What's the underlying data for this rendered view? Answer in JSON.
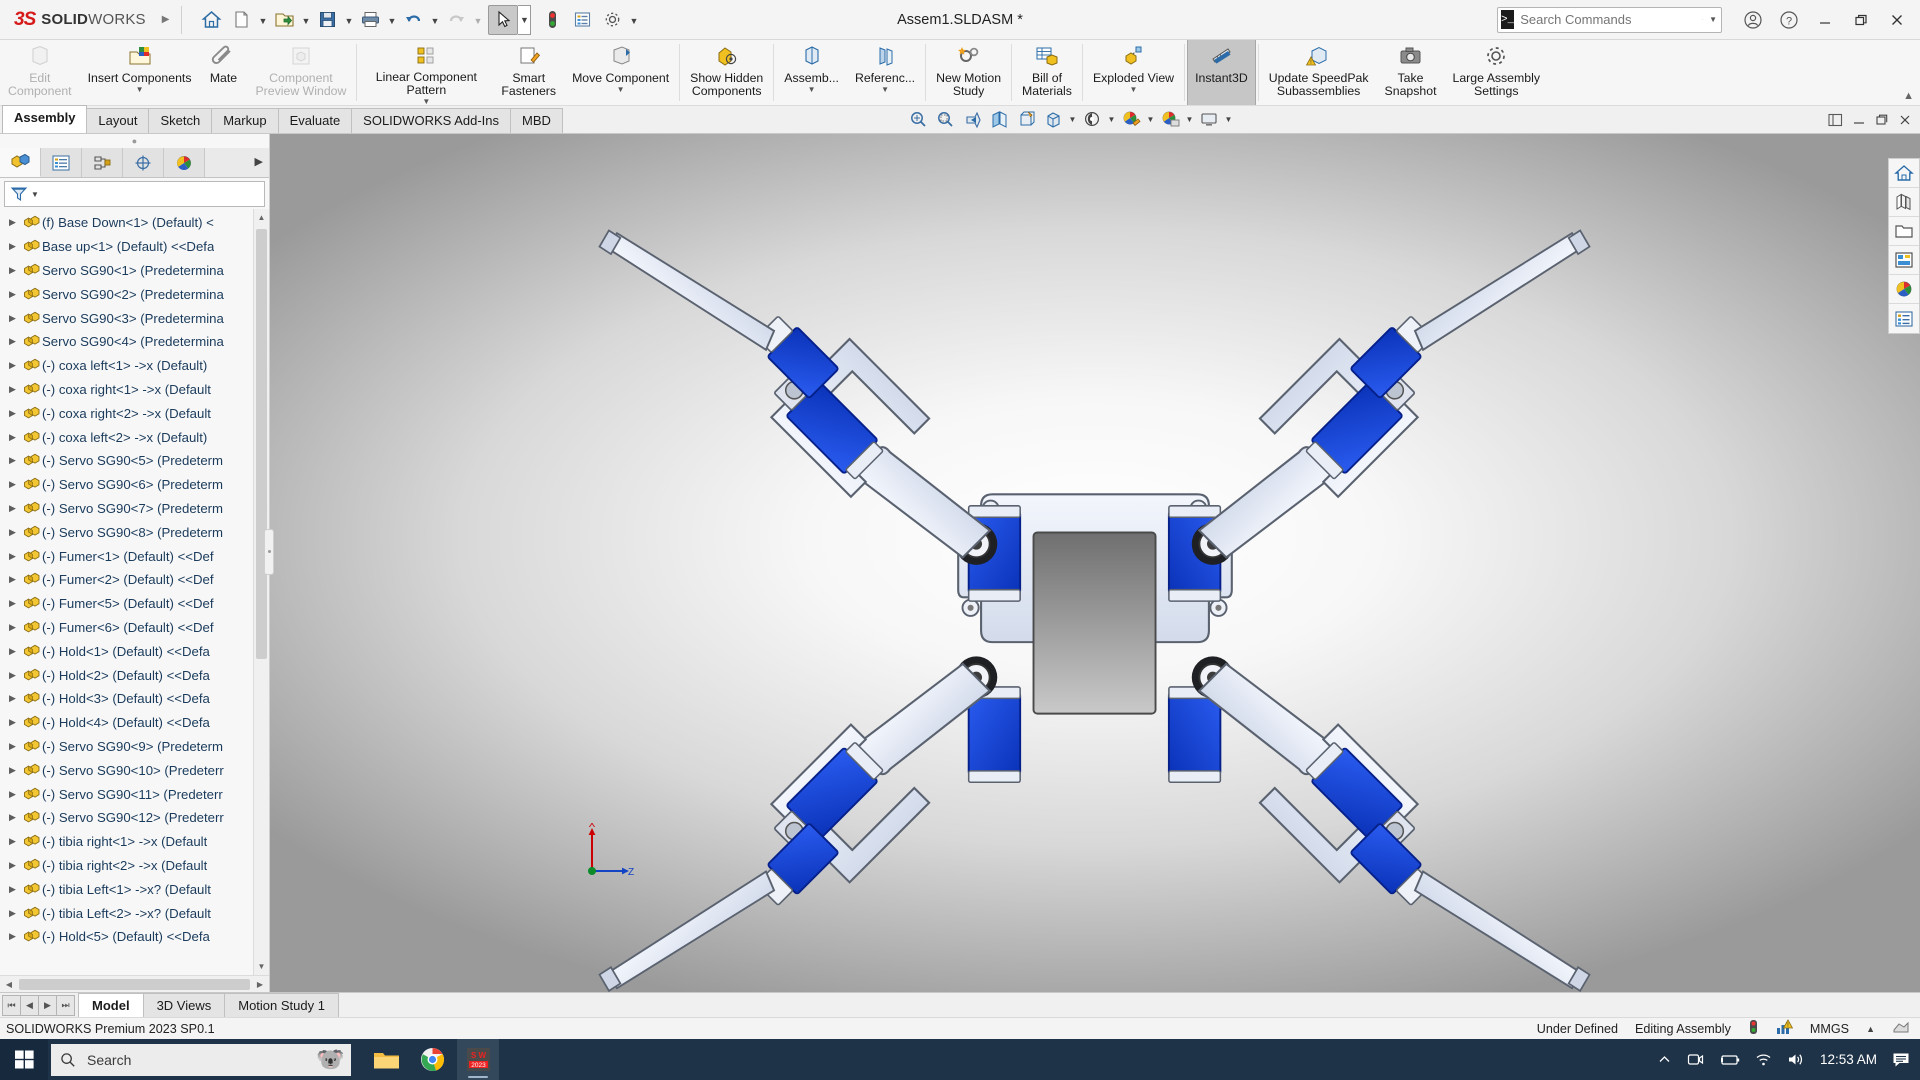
{
  "titlebar": {
    "brand_ds": "3S",
    "brand_bold": "SOLID",
    "brand_light": "WORKS",
    "document_title": "Assem1.SLDASM *",
    "quick_access": [
      {
        "name": "home-icon",
        "label": "Home"
      },
      {
        "name": "new-document-icon",
        "label": "New"
      },
      {
        "name": "open-document-icon",
        "label": "Open"
      },
      {
        "name": "save-icon",
        "label": "Save"
      },
      {
        "name": "print-icon",
        "label": "Print"
      },
      {
        "name": "undo-icon",
        "label": "Undo"
      },
      {
        "name": "redo-icon",
        "label": "Redo"
      },
      {
        "name": "select-cursor-icon",
        "label": "Select"
      },
      {
        "name": "rebuild-icon",
        "label": "Rebuild"
      },
      {
        "name": "file-properties-icon",
        "label": "File Properties"
      },
      {
        "name": "options-gear-icon",
        "label": "Options"
      }
    ],
    "search_placeholder": "Search Commands",
    "window_controls": [
      "minimize",
      "restore",
      "close"
    ]
  },
  "ribbon": {
    "items": [
      {
        "label": "Edit\nComponent",
        "icon": "edit-component-icon",
        "disabled": true,
        "caret": false
      },
      {
        "label": "Insert Components",
        "icon": "insert-components-icon",
        "disabled": false,
        "caret": true
      },
      {
        "label": "Mate",
        "icon": "mate-paperclip-icon",
        "disabled": false,
        "caret": false
      },
      {
        "label": "Component\nPreview Window",
        "icon": "component-preview-icon",
        "disabled": true,
        "caret": false
      },
      {
        "label": "Linear Component Pattern",
        "icon": "linear-pattern-icon",
        "disabled": false,
        "caret": true
      },
      {
        "label": "Smart\nFasteners",
        "icon": "smart-fasteners-icon",
        "disabled": false,
        "caret": false
      },
      {
        "label": "Move Component",
        "icon": "move-component-icon",
        "disabled": false,
        "caret": true
      },
      {
        "label": "Show Hidden\nComponents",
        "icon": "show-hidden-components-icon",
        "disabled": false,
        "caret": false
      },
      {
        "label": "Assemb...",
        "icon": "assembly-features-icon",
        "disabled": false,
        "caret": true
      },
      {
        "label": "Referenc...",
        "icon": "reference-geometry-icon",
        "disabled": false,
        "caret": true
      },
      {
        "label": "New Motion\nStudy",
        "icon": "new-motion-study-icon",
        "disabled": false,
        "caret": false
      },
      {
        "label": "Bill of\nMaterials",
        "icon": "bill-of-materials-icon",
        "disabled": false,
        "caret": false
      },
      {
        "label": "Exploded View",
        "icon": "exploded-view-icon",
        "disabled": false,
        "caret": true
      },
      {
        "label": "Instant3D",
        "icon": "instant3d-icon",
        "disabled": false,
        "caret": false,
        "selected": true
      },
      {
        "label": "Update SpeedPak\nSubassemblies",
        "icon": "update-speedpak-icon",
        "disabled": false,
        "caret": false
      },
      {
        "label": "Take\nSnapshot",
        "icon": "take-snapshot-icon",
        "disabled": false,
        "caret": false
      },
      {
        "label": "Large Assembly\nSettings",
        "icon": "large-assembly-settings-icon",
        "disabled": false,
        "caret": false
      }
    ]
  },
  "command_tabs": [
    {
      "label": "Assembly",
      "active": true
    },
    {
      "label": "Layout",
      "active": false
    },
    {
      "label": "Sketch",
      "active": false
    },
    {
      "label": "Markup",
      "active": false
    },
    {
      "label": "Evaluate",
      "active": false
    },
    {
      "label": "SOLIDWORKS Add-Ins",
      "active": false
    },
    {
      "label": "MBD",
      "active": false
    }
  ],
  "view_toolbar": [
    {
      "name": "zoom-to-fit-icon",
      "caret": false
    },
    {
      "name": "zoom-to-area-icon",
      "caret": false
    },
    {
      "name": "previous-view-icon",
      "caret": false
    },
    {
      "name": "section-view-icon",
      "caret": false
    },
    {
      "name": "view-orientation-icon",
      "caret": false
    },
    {
      "name": "display-style-icon",
      "caret": true
    },
    {
      "name": "hide-show-items-icon",
      "caret": true
    },
    {
      "name": "edit-appearance-icon",
      "caret": true
    },
    {
      "name": "apply-scene-icon",
      "caret": true
    },
    {
      "name": "view-settings-icon",
      "caret": true
    }
  ],
  "feature_manager": {
    "panel_tabs": [
      {
        "name": "featuremanager-design-tree-tab",
        "active": true
      },
      {
        "name": "property-manager-tab",
        "active": false
      },
      {
        "name": "configuration-manager-tab",
        "active": false
      },
      {
        "name": "dimxpert-manager-tab",
        "active": false
      },
      {
        "name": "display-manager-tab",
        "active": false
      }
    ],
    "filter_placeholder": "",
    "tree_items": [
      "(f) Base Down<1> (Default) <",
      "Base up<1> (Default) <<Defa",
      "Servo SG90<1> (Predetermina",
      "Servo SG90<2> (Predetermina",
      "Servo SG90<3> (Predetermina",
      "Servo SG90<4> (Predetermina",
      "(-) coxa left<1> ->x (Default)",
      "(-) coxa right<1> ->x (Default",
      "(-) coxa right<2> ->x (Default",
      "(-) coxa left<2> ->x (Default)",
      "(-) Servo SG90<5> (Predeterm",
      "(-) Servo SG90<6> (Predeterm",
      "(-) Servo SG90<7> (Predeterm",
      "(-) Servo SG90<8> (Predeterm",
      "(-) Fumer<1> (Default) <<Def",
      "(-) Fumer<2> (Default) <<Def",
      "(-) Fumer<5> (Default) <<Def",
      "(-) Fumer<6> (Default) <<Def",
      "(-) Hold<1> (Default) <<Defa",
      "(-) Hold<2> (Default) <<Defa",
      "(-) Hold<3> (Default) <<Defa",
      "(-) Hold<4> (Default) <<Defa",
      "(-) Servo SG90<9> (Predeterm",
      "(-) Servo SG90<10> (Predeterr",
      "(-) Servo SG90<11> (Predeterr",
      "(-) Servo SG90<12> (Predeterr",
      "(-) tibia right<1> ->x (Default",
      "(-) tibia right<2> ->x (Default",
      "(-) tibia Left<1> ->x? (Default",
      "(-) tibia Left<2> ->x? (Default",
      "(-) Hold<5> (Default) <<Defa"
    ]
  },
  "graphics": {
    "triad": {
      "x_label": "X",
      "z_label": "Z"
    },
    "view_side_buttons": [
      {
        "name": "home-view-icon"
      },
      {
        "name": "appearances-icon"
      },
      {
        "name": "open-folder-icon"
      },
      {
        "name": "custom-properties-icon"
      },
      {
        "name": "render-appearance-icon"
      },
      {
        "name": "display-pane-icon"
      }
    ]
  },
  "bottom_tabs": [
    {
      "label": "Model",
      "active": true
    },
    {
      "label": "3D Views",
      "active": false
    },
    {
      "label": "Motion Study 1",
      "active": false
    }
  ],
  "status_bar": {
    "left": "SOLIDWORKS Premium 2023 SP0.1",
    "under_defined": "Under Defined",
    "editing": "Editing Assembly",
    "units": "MMGS"
  },
  "taskbar": {
    "search_placeholder": "Search",
    "apps": [
      {
        "name": "file-explorer-icon",
        "active": false
      },
      {
        "name": "chrome-icon",
        "active": false
      },
      {
        "name": "solidworks-2023-icon",
        "active": true,
        "label": "2023"
      }
    ],
    "clock": "12:53 AM",
    "tray": [
      "chevron-up-icon",
      "onedrive-icon",
      "battery-icon",
      "wifi-icon",
      "volume-icon",
      "action-center-icon"
    ]
  },
  "colors": {
    "accent_blue": "#1045d8",
    "part_light": "#e3e9f5",
    "brand_red": "#d61a1a",
    "ribbon_bg": "#f6f6f6",
    "taskbar_bg": "#1f3348"
  }
}
